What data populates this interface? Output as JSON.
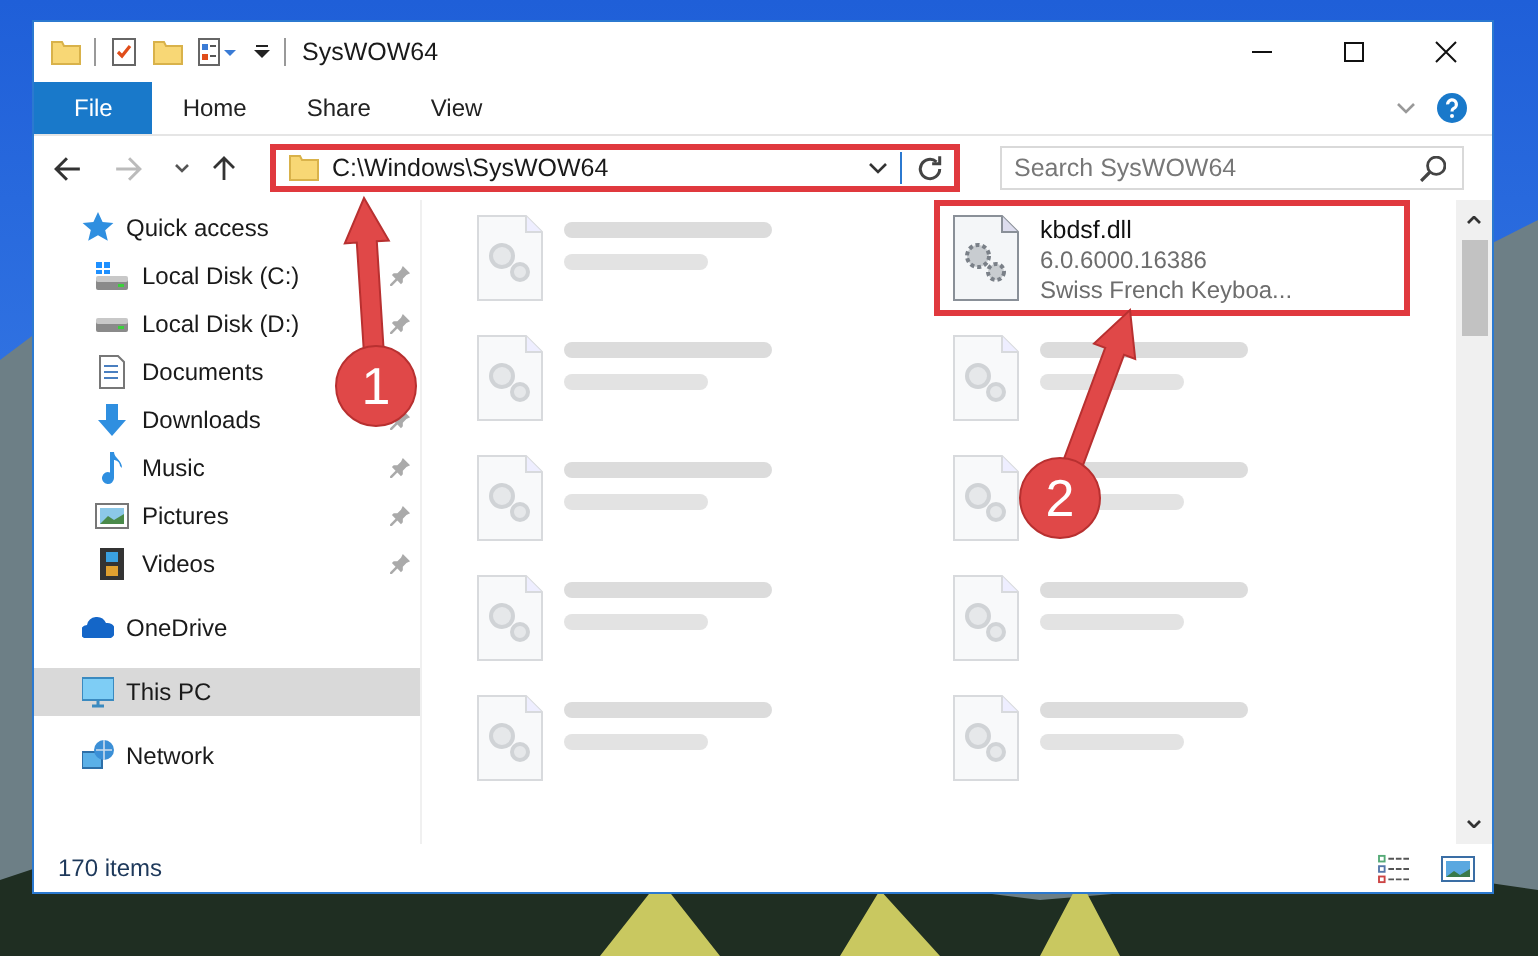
{
  "window": {
    "title": "SysWOW64"
  },
  "ribbon": {
    "tabs": [
      {
        "label": "File",
        "selected": true
      },
      {
        "label": "Home",
        "selected": false
      },
      {
        "label": "Share",
        "selected": false
      },
      {
        "label": "View",
        "selected": false
      }
    ]
  },
  "address_bar": {
    "path": "C:\\Windows\\SysWOW64",
    "highlighted": true
  },
  "search": {
    "placeholder": "Search SysWOW64"
  },
  "sidebar": {
    "items": [
      {
        "label": "Quick access",
        "selected": false,
        "children": [
          {
            "label": "Local Disk (C:)",
            "pinned": true,
            "selected": false
          },
          {
            "label": "Local Disk (D:)",
            "pinned": true,
            "selected": false
          },
          {
            "label": "Documents",
            "selected": false
          },
          {
            "label": "Downloads",
            "pinned": true,
            "selected": false
          },
          {
            "label": "Music",
            "pinned": true,
            "selected": false
          },
          {
            "label": "Pictures",
            "pinned": true,
            "selected": false
          },
          {
            "label": "Videos",
            "pinned": true,
            "selected": false
          }
        ]
      },
      {
        "label": "OneDrive",
        "selected": false
      },
      {
        "label": "This PC",
        "selected": true
      },
      {
        "label": "Network",
        "selected": false
      }
    ]
  },
  "files": [
    {
      "blurred": true
    },
    {
      "name": "kbdsf.dll",
      "line_2": "6.0.6000.16386",
      "line_3": "Swiss French Keyboa...",
      "blurred": false,
      "highlighted": true
    },
    {
      "blurred": true
    },
    {
      "blurred": true
    },
    {
      "blurred": true
    },
    {
      "blurred": true
    },
    {
      "blurred": true
    },
    {
      "blurred": true
    },
    {
      "blurred": true
    },
    {
      "blurred": true
    }
  ],
  "status_bar": {
    "item_count": "170 items"
  },
  "callouts": [
    {
      "number": "1"
    },
    {
      "number": "2"
    }
  ]
}
